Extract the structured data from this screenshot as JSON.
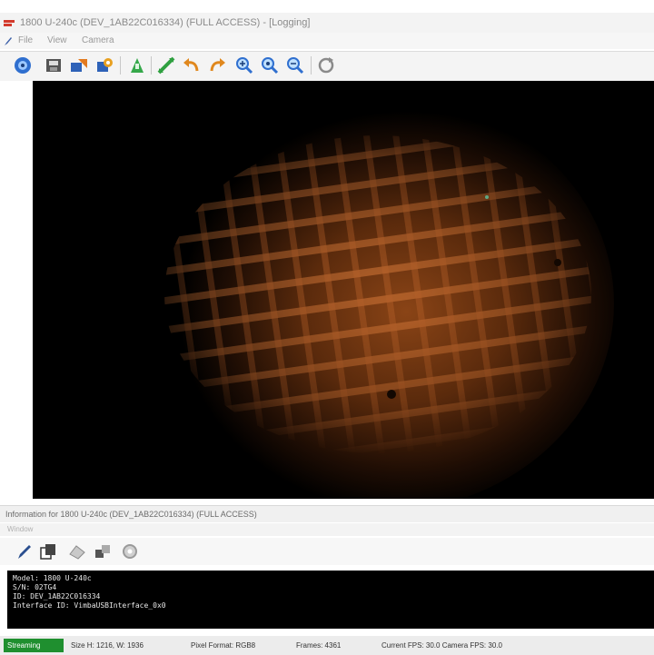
{
  "window": {
    "title": "1800 U-240c (DEV_1AB22C016334) (FULL ACCESS) - [Logging]"
  },
  "menu": {
    "items": [
      "File",
      "View",
      "Camera"
    ]
  },
  "toolbar": {
    "buttons": [
      "open-camera-icon",
      "save-image-icon",
      "export-icon",
      "settings-icon",
      "trigger-icon",
      "fit-window-icon",
      "undo-icon",
      "redo-icon",
      "zoom-in-icon",
      "zoom-100-icon",
      "zoom-out-icon",
      "refresh-icon"
    ]
  },
  "info": {
    "label": "Information for 1800 U-240c (DEV_1AB22C016334) (FULL ACCESS)"
  },
  "panel": {
    "label": "Window"
  },
  "console": {
    "lines": [
      "Model: 1800 U-240c",
      "S/N: 02TG4",
      "ID: DEV_1AB22C016334",
      "Interface ID: VimbaUSBInterface_0x0"
    ]
  },
  "status": {
    "state": "Streaming",
    "size": "Size H: 1216, W: 1936",
    "pixel_format": "Pixel Format: RGB8",
    "frames": "Frames: 4361",
    "current": "Current FPS: 30.0 Camera FPS: 30.0"
  },
  "colors": {
    "accent": "#1f8f2f",
    "viewer_glow": "#7a3a12",
    "grid_highlight": "#d77a3b"
  }
}
